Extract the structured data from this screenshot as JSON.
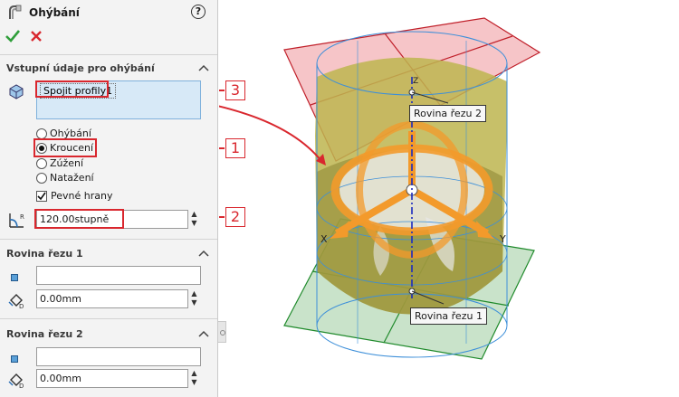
{
  "feature": {
    "icon": "flex-feature-icon",
    "title": "Ohýbání",
    "help_icon": "help-icon",
    "ok_icon": "checkmark-icon",
    "cancel_icon": "close-icon"
  },
  "input_section": {
    "title": "Vstupní údaje pro ohýbání",
    "body_label": "Spojit profily1",
    "options": [
      {
        "label": "Ohýbání",
        "selected": false
      },
      {
        "label": "Kroucení",
        "selected": true
      },
      {
        "label": "Zúžení",
        "selected": false
      },
      {
        "label": "Natažení",
        "selected": false
      }
    ],
    "hard_edges_label": "Pevné hrany",
    "hard_edges_checked": true,
    "angle_value": "120.00stupně"
  },
  "trim_plane_1": {
    "title": "Rovina řezu 1",
    "reference": "",
    "distance": "0.00mm"
  },
  "trim_plane_2": {
    "title": "Rovina řezu 2",
    "reference": "",
    "distance": "0.00mm"
  },
  "callouts": [
    "1",
    "2",
    "3"
  ],
  "viewport": {
    "plane_tag_1": "Rovina řezu 1",
    "plane_tag_2": "Rovina řezu 2",
    "axis_x": "X",
    "axis_y": "Y",
    "axis_z": "Z"
  },
  "colors": {
    "accent_red": "#d9272e",
    "ok_green": "#2f9e3a",
    "plane_red": "#f3b1b6",
    "plane_green": "#b7d9b8",
    "body_olive": "#bdb54f",
    "flex_orange": "#f39a2b",
    "outline_blue": "#3d8fd9"
  }
}
